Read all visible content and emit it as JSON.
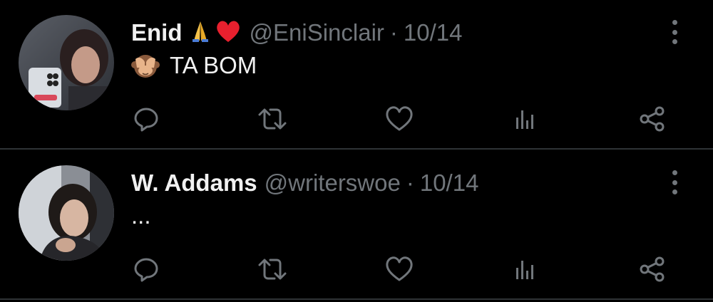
{
  "colors": {
    "background": "#000000",
    "divider": "#2f3336",
    "primary_text": "#f1f1f1",
    "secondary_text": "#71767b",
    "icon": "#71767b"
  },
  "tweets": [
    {
      "display_name": "Enid",
      "name_emojis": [
        "folded-hands-emoji",
        "red-heart-emoji"
      ],
      "handle": "@EniSinclair",
      "separator": "·",
      "date": "10/14",
      "body_emoji": "see-no-evil-monkey-emoji",
      "body_text": "TA BOM",
      "actions": [
        "reply-icon",
        "retweet-icon",
        "like-icon",
        "views-icon",
        "share-icon"
      ]
    },
    {
      "display_name": "W. Addams",
      "handle": "@writerswoe",
      "separator": "·",
      "date": "10/14",
      "body_text": "...",
      "actions": [
        "reply-icon",
        "retweet-icon",
        "like-icon",
        "views-icon",
        "share-icon"
      ]
    }
  ]
}
